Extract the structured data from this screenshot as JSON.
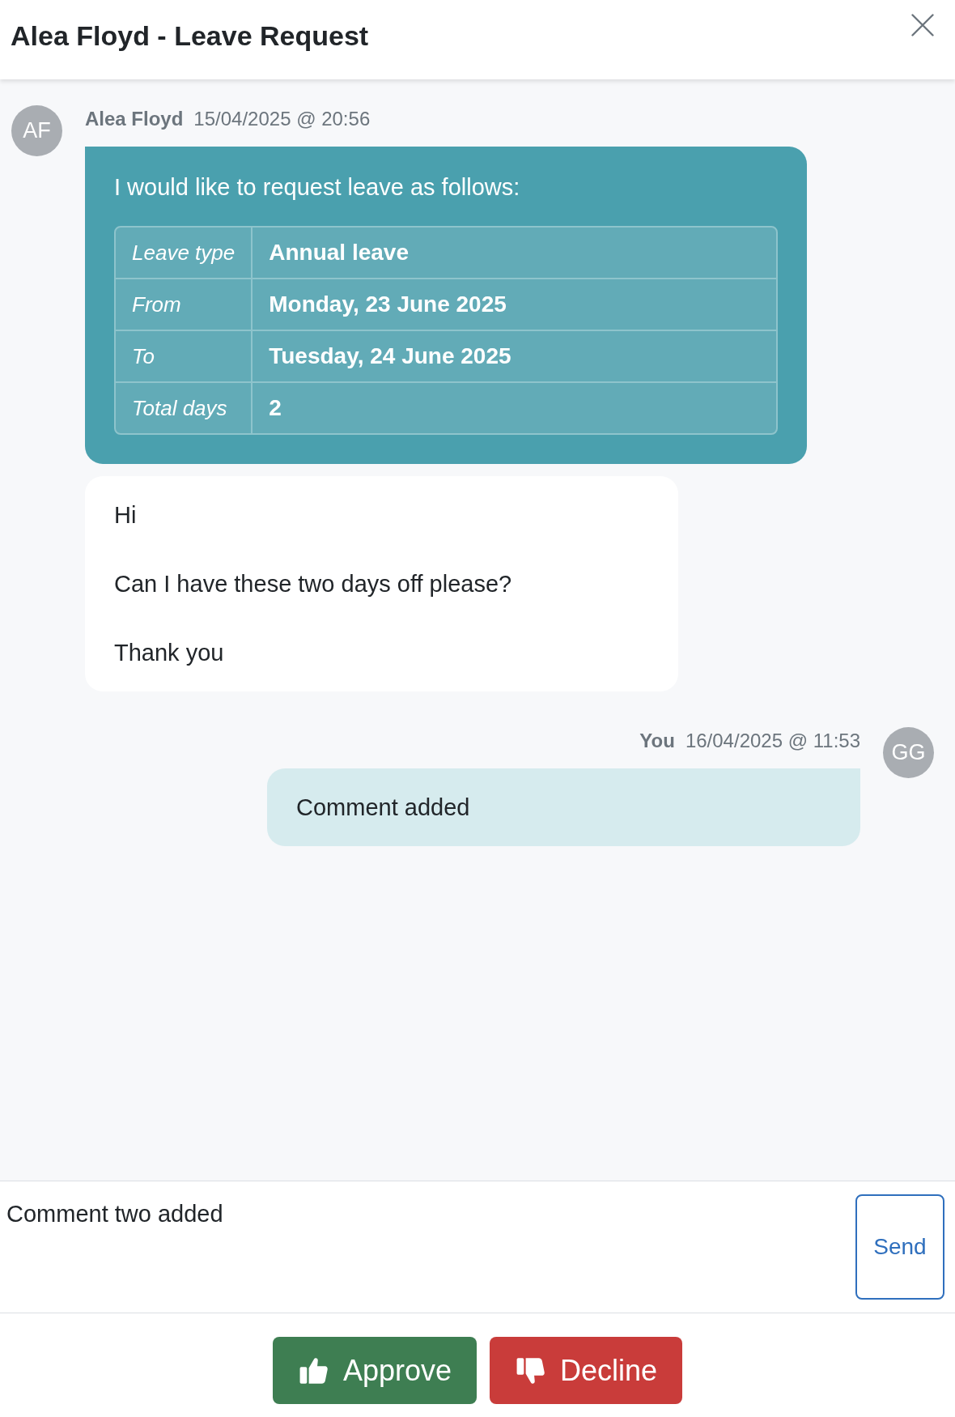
{
  "title": "Alea Floyd - Leave Request",
  "thread": [
    {
      "initials": "AF",
      "author": "Alea Floyd",
      "time": "15/04/2025 @ 20:56",
      "outgoing": false,
      "bubbles": [
        {
          "kind": "request",
          "intro": "I would like to request leave as follows:",
          "rows": [
            {
              "label": "Leave type",
              "value": "Annual leave"
            },
            {
              "label": "From",
              "value": "Monday, 23 June 2025"
            },
            {
              "label": "To",
              "value": "Tuesday, 24 June 2025"
            },
            {
              "label": "Total days",
              "value": "2"
            }
          ]
        },
        {
          "kind": "text",
          "paragraphs": [
            "Hi",
            "Can I have these two days off please?",
            "Thank you"
          ]
        }
      ]
    },
    {
      "initials": "GG",
      "author": "You",
      "time": "16/04/2025 @ 11:53",
      "outgoing": true,
      "bubbles": [
        {
          "kind": "text",
          "paragraphs": [
            "Comment added"
          ]
        }
      ]
    }
  ],
  "composer": {
    "value": "Comment two added",
    "send": "Send"
  },
  "actions": [
    {
      "kind": "approve",
      "label": "Approve"
    },
    {
      "kind": "decline",
      "label": "Decline"
    }
  ]
}
